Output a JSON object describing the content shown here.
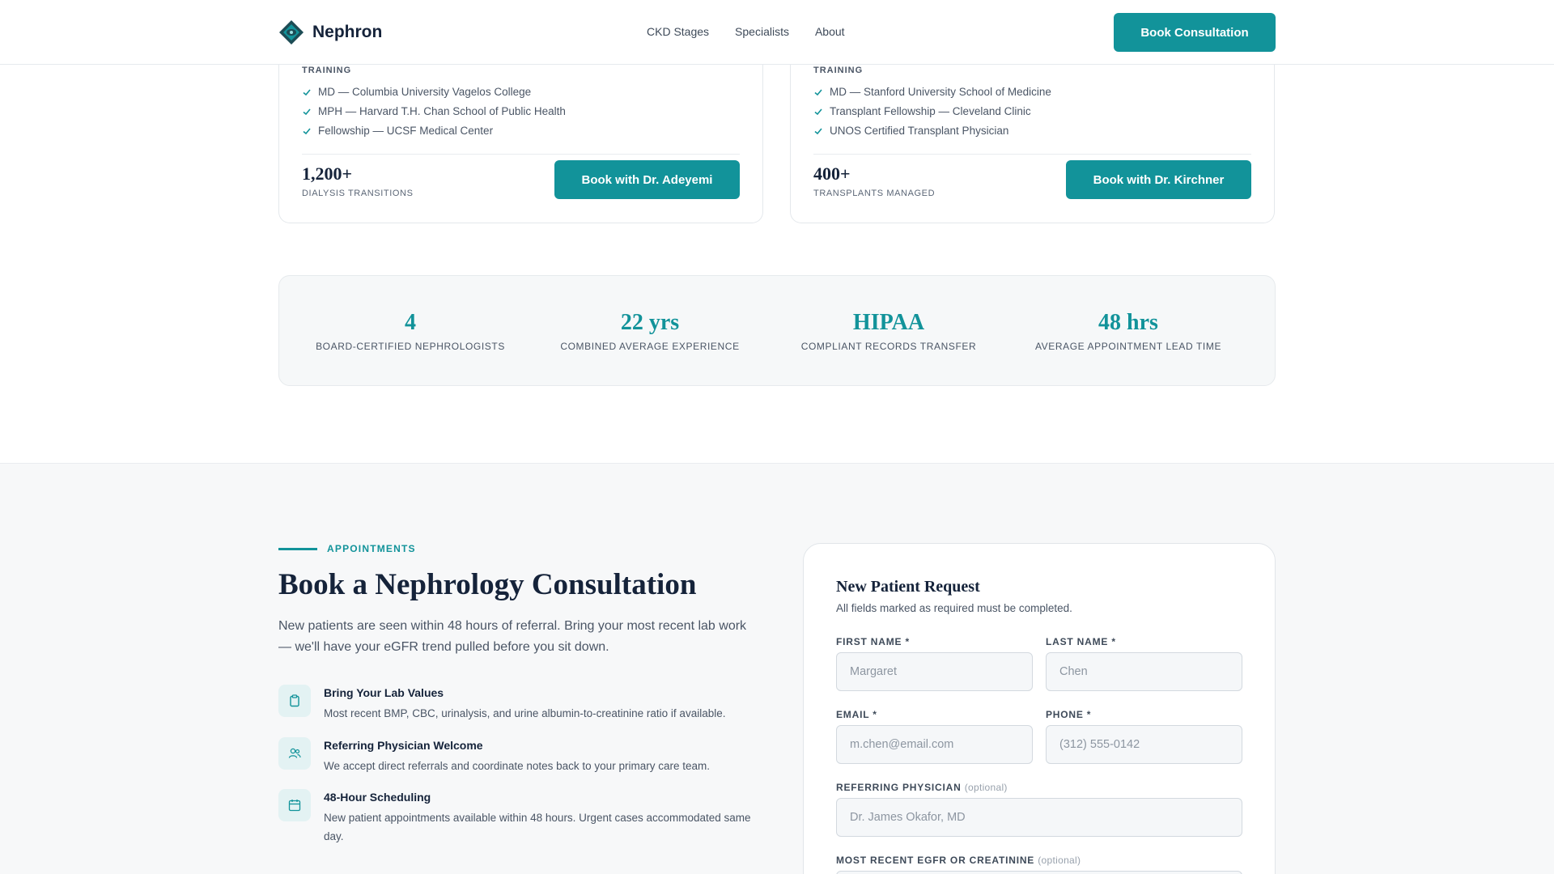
{
  "header": {
    "brand": "Nephron",
    "nav": [
      "CKD Stages",
      "Specialists",
      "About"
    ],
    "cta": "Book Consultation"
  },
  "specialists": [
    {
      "training_label": "TRAINING",
      "training": [
        "MD — Columbia University Vagelos College",
        "MPH — Harvard T.H. Chan School of Public Health",
        "Fellowship — UCSF Medical Center"
      ],
      "stat_value": "1,200+",
      "stat_label": "DIALYSIS TRANSITIONS",
      "button": "Book with Dr. Adeyemi"
    },
    {
      "training_label": "TRAINING",
      "training": [
        "MD — Stanford University School of Medicine",
        "Transplant Fellowship — Cleveland Clinic",
        "UNOS Certified Transplant Physician"
      ],
      "stat_value": "400+",
      "stat_label": "TRANSPLANTS MANAGED",
      "button": "Book with Dr. Kirchner"
    }
  ],
  "stats": [
    {
      "value": "4",
      "label": "BOARD-CERTIFIED NEPHROLOGISTS"
    },
    {
      "value": "22 yrs",
      "label": "COMBINED AVERAGE EXPERIENCE"
    },
    {
      "value": "HIPAA",
      "label": "COMPLIANT RECORDS TRANSFER"
    },
    {
      "value": "48 hrs",
      "label": "AVERAGE APPOINTMENT LEAD TIME"
    }
  ],
  "appointments": {
    "eyebrow": "APPOINTMENTS",
    "title": "Book a Nephrology Consultation",
    "intro": "New patients are seen within 48 hours of referral. Bring your most recent lab work — we'll have your eGFR trend pulled before you sit down.",
    "features": [
      {
        "icon": "clipboard-icon",
        "title": "Bring Your Lab Values",
        "desc": "Most recent BMP, CBC, urinalysis, and urine albumin-to-creatinine ratio if available."
      },
      {
        "icon": "users-icon",
        "title": "Referring Physician Welcome",
        "desc": "We accept direct referrals and coordinate notes back to your primary care team."
      },
      {
        "icon": "calendar-icon",
        "title": "48-Hour Scheduling",
        "desc": "New patient appointments available within 48 hours. Urgent cases accommodated same day."
      }
    ]
  },
  "form": {
    "title": "New Patient Request",
    "subtitle": "All fields marked as required must be completed.",
    "first_name": {
      "label": "FIRST NAME *",
      "placeholder": "Margaret"
    },
    "last_name": {
      "label": "LAST NAME *",
      "placeholder": "Chen"
    },
    "email": {
      "label": "EMAIL *",
      "placeholder": "m.chen@email.com"
    },
    "phone": {
      "label": "PHONE *",
      "placeholder": "(312) 555-0142"
    },
    "referring": {
      "label": "REFERRING PHYSICIAN",
      "optional": "(optional)",
      "placeholder": "Dr. James Okafor, MD"
    },
    "egfr": {
      "label": "MOST RECENT EGFR OR CREATININE",
      "optional": "(optional)"
    }
  },
  "colors": {
    "accent": "#12939a",
    "ink": "#15233a",
    "muted": "#4a5565"
  }
}
